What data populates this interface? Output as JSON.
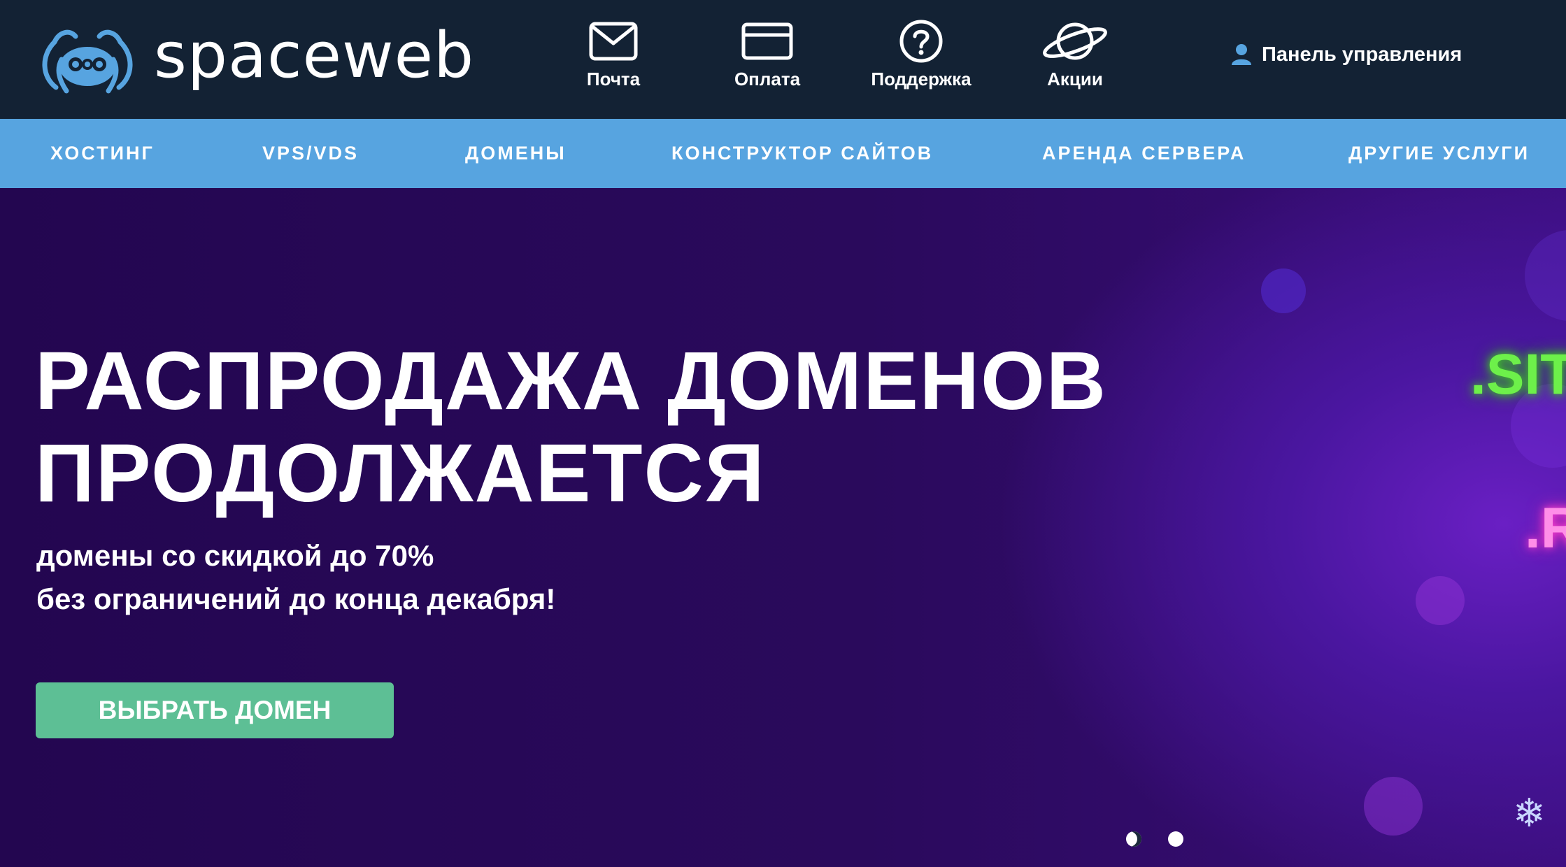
{
  "brand": {
    "name": "spaceweb",
    "color": "#57a4e0"
  },
  "topnav": [
    {
      "label": "Почта",
      "icon": "mail-icon"
    },
    {
      "label": "Оплата",
      "icon": "card-icon"
    },
    {
      "label": "Поддержка",
      "icon": "help-icon"
    },
    {
      "label": "Акции",
      "icon": "planet-icon"
    }
  ],
  "panel": {
    "label": "Панель управления",
    "icon": "user-icon"
  },
  "mainnav": [
    {
      "label": "ХОСТИНГ"
    },
    {
      "label": "VPS/VDS"
    },
    {
      "label": "ДОМЕНЫ"
    },
    {
      "label": "КОНСТРУКТОР САЙТОВ"
    },
    {
      "label": "АРЕНДА СЕРВЕРА"
    },
    {
      "label": "ДРУГИЕ УСЛУГИ"
    }
  ],
  "hero": {
    "title_line1": "РАСПРОДАЖА ДОМЕНОВ",
    "title_line2": "ПРОДОЛЖАЕТСЯ",
    "subtitle_line1": "домены со скидкой до 70%",
    "subtitle_line2": "без ограничений до конца декабря!",
    "button": "ВЫБРАТЬ ДОМЕН",
    "neon_1": ".SIT",
    "neon_2": ".R",
    "snowflake": "❄"
  },
  "carousel": {
    "slides": 2,
    "active": 1
  },
  "colors": {
    "header_bg": "#132234",
    "nav_bg": "#57a4e0",
    "hero_bg": "#2a0a5a",
    "button_bg": "#5dbf95"
  }
}
